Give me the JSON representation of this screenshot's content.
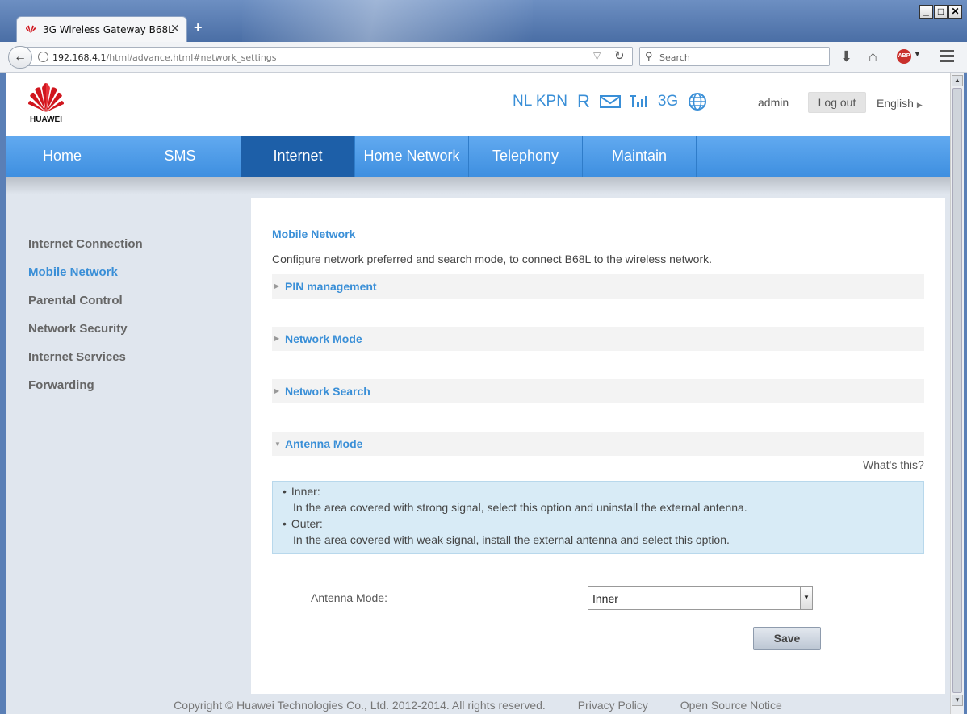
{
  "browser": {
    "tab_title": "3G Wireless Gateway B68L",
    "url_host": "192.168.4.1",
    "url_path": "/html/advance.html#network_settings",
    "search_placeholder": "Search",
    "abp_label": "ABP"
  },
  "header": {
    "brand": "HUAWEI",
    "operator": "NL KPN",
    "roaming": "R",
    "network_type": "3G",
    "user": "admin",
    "logout_label": "Log out",
    "language": "English"
  },
  "mainnav": {
    "items": [
      {
        "label": "Home"
      },
      {
        "label": "SMS"
      },
      {
        "label": "Internet"
      },
      {
        "label": "Home Network"
      },
      {
        "label": "Telephony"
      },
      {
        "label": "Maintain"
      }
    ],
    "active": "Internet"
  },
  "sidebar": {
    "items": [
      {
        "label": "Internet Connection"
      },
      {
        "label": "Mobile Network"
      },
      {
        "label": "Parental Control"
      },
      {
        "label": "Network Security"
      },
      {
        "label": "Internet Services"
      },
      {
        "label": "Forwarding"
      }
    ],
    "active": "Mobile Network"
  },
  "content": {
    "title": "Mobile Network",
    "description": "Configure network preferred and search mode, to connect B68L to the wireless network.",
    "sections": [
      {
        "label": "PIN management",
        "expanded": false
      },
      {
        "label": "Network Mode",
        "expanded": false
      },
      {
        "label": "Network Search",
        "expanded": false
      },
      {
        "label": "Antenna Mode",
        "expanded": true
      }
    ],
    "whats_this": "What's this?",
    "info": {
      "inner_title": "Inner:",
      "inner_text": "In the area covered with strong signal, select this option and uninstall the external antenna.",
      "outer_title": "Outer:",
      "outer_text": "In the area covered with weak signal, install the external antenna and select this option."
    },
    "antenna_label": "Antenna Mode:",
    "antenna_value": "Inner",
    "save_label": "Save"
  },
  "footer": {
    "copyright": "Copyright © Huawei Technologies Co., Ltd. 2012-2014. All rights reserved.",
    "privacy": "Privacy Policy",
    "open_source": "Open Source Notice"
  },
  "colors": {
    "accent": "#3a8fd7",
    "nav_active": "#1d5fa8",
    "info_bg": "#d8ebf6"
  }
}
